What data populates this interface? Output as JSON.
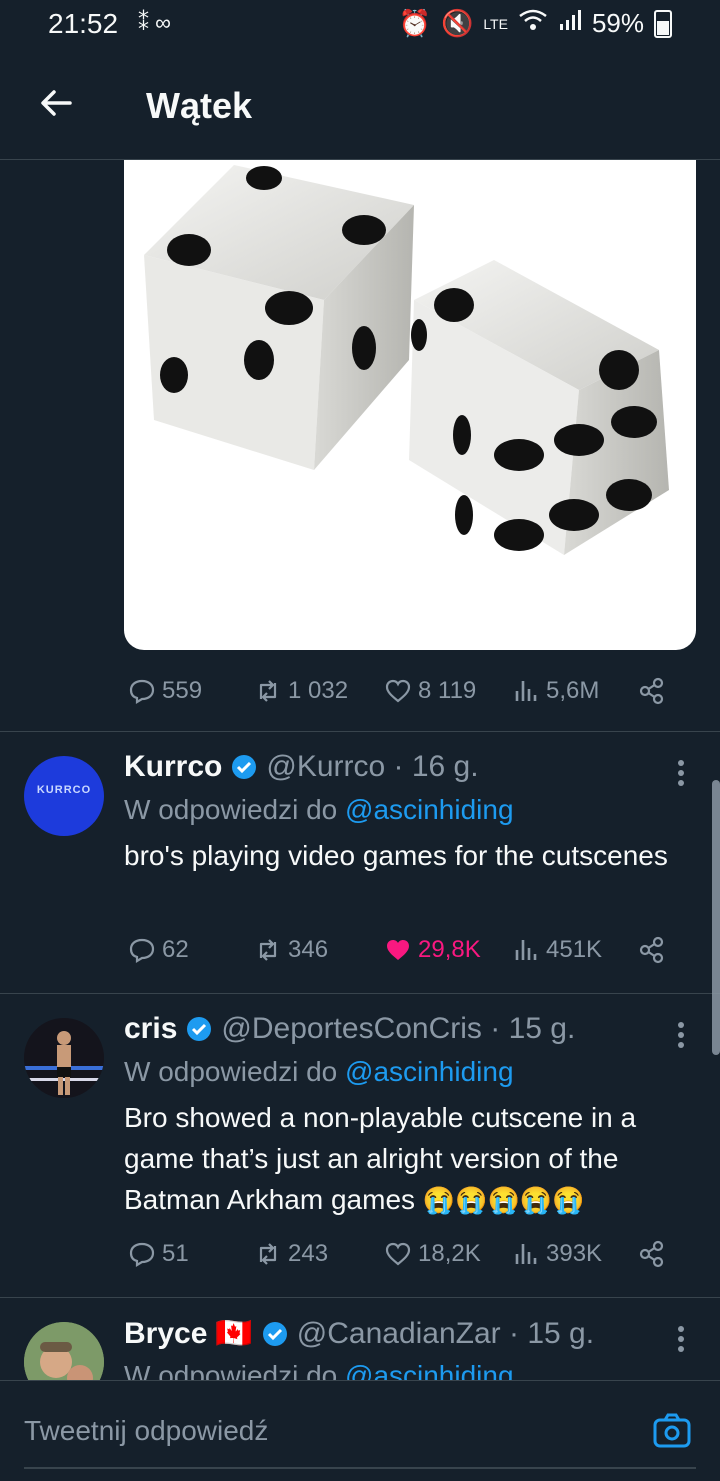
{
  "status": {
    "time": "21:52",
    "battery": "59%",
    "lte": "LTE"
  },
  "header": {
    "title": "Wątek"
  },
  "main_tweet_stats": {
    "replies": "559",
    "retweets": "1 032",
    "likes": "8 119",
    "views": "5,6M"
  },
  "replies": [
    {
      "name": "Kurrco",
      "handle": "@Kurrco · 16 g.",
      "reply_prefix": "W odpowiedzi do ",
      "reply_to": "@ascinhiding",
      "text": "bro's playing video games for the cutscenes",
      "stats": {
        "replies": "62",
        "retweets": "346",
        "likes": "29,8K",
        "views": "451K"
      },
      "liked": true,
      "avatar_text": "KURRCO"
    },
    {
      "name": "cris",
      "handle": "@DeportesConCris · 15 g.",
      "reply_prefix": "W odpowiedzi do ",
      "reply_to": "@ascinhiding",
      "text": "Bro showed a non-playable cutscene in a game that’s just an alright version of the Batman Arkham games",
      "emoji": "😭😭😭😭😭",
      "stats": {
        "replies": "51",
        "retweets": "243",
        "likes": "18,2K",
        "views": "393K"
      },
      "liked": false
    },
    {
      "name": "Bryce",
      "flag": "🇨🇦",
      "handle": "@CanadianZar · 15 g.",
      "reply_prefix": "W odpowiedzi do ",
      "reply_to": "@ascinhiding"
    }
  ],
  "composer": {
    "placeholder": "Tweetnij odpowiedź"
  },
  "colors": {
    "background": "#15202b",
    "accent": "#1d9bf0",
    "like": "#f91880",
    "muted": "#8b98a5"
  }
}
